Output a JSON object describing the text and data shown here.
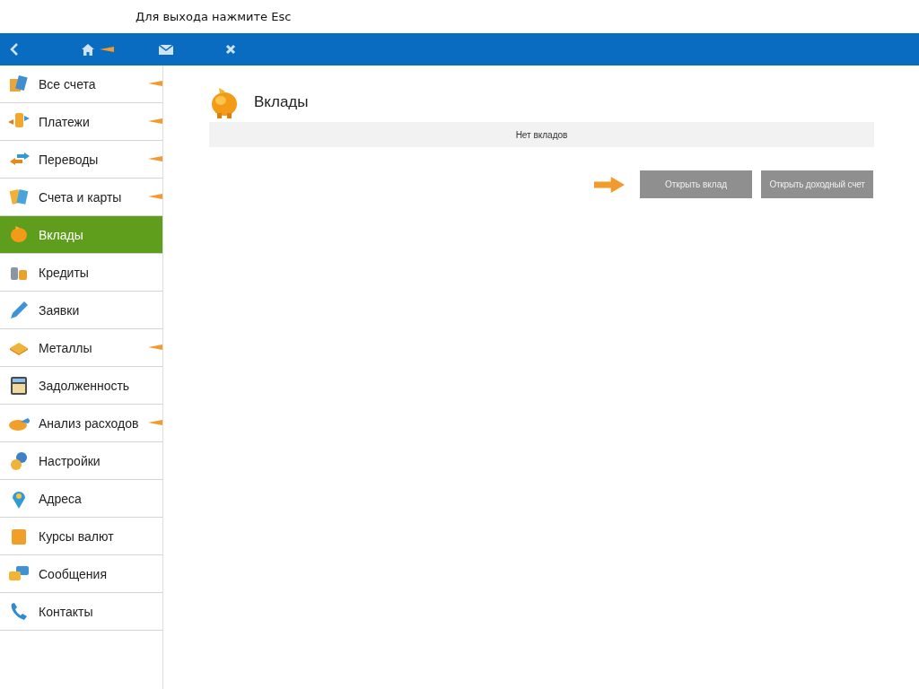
{
  "hint": "Для выхода нажмите Esc",
  "toolbar": {
    "home_marked": true
  },
  "sidebar": {
    "items": [
      {
        "label": "Все счета",
        "selected": false,
        "marked": true
      },
      {
        "label": "Платежи",
        "selected": false,
        "marked": true
      },
      {
        "label": "Переводы",
        "selected": false,
        "marked": true
      },
      {
        "label": "Счета и карты",
        "selected": false,
        "marked": true
      },
      {
        "label": "Вклады",
        "selected": true,
        "marked": false
      },
      {
        "label": "Кредиты",
        "selected": false,
        "marked": false
      },
      {
        "label": "Заявки",
        "selected": false,
        "marked": false
      },
      {
        "label": "Металлы",
        "selected": false,
        "marked": true
      },
      {
        "label": "Задолженность",
        "selected": false,
        "marked": false
      },
      {
        "label": "Анализ расходов",
        "selected": false,
        "marked": true
      },
      {
        "label": "Настройки",
        "selected": false,
        "marked": false
      },
      {
        "label": "Адреса",
        "selected": false,
        "marked": false
      },
      {
        "label": "Курсы валют",
        "selected": false,
        "marked": false
      },
      {
        "label": "Сообщения",
        "selected": false,
        "marked": false
      },
      {
        "label": "Контакты",
        "selected": false,
        "marked": false
      }
    ]
  },
  "main": {
    "title": "Вклады",
    "empty_message": "Нет вкладов",
    "buttons": [
      {
        "label": "Открыть вклад",
        "marked": true
      },
      {
        "label": "Открыть доходный счет",
        "marked": false
      }
    ]
  }
}
